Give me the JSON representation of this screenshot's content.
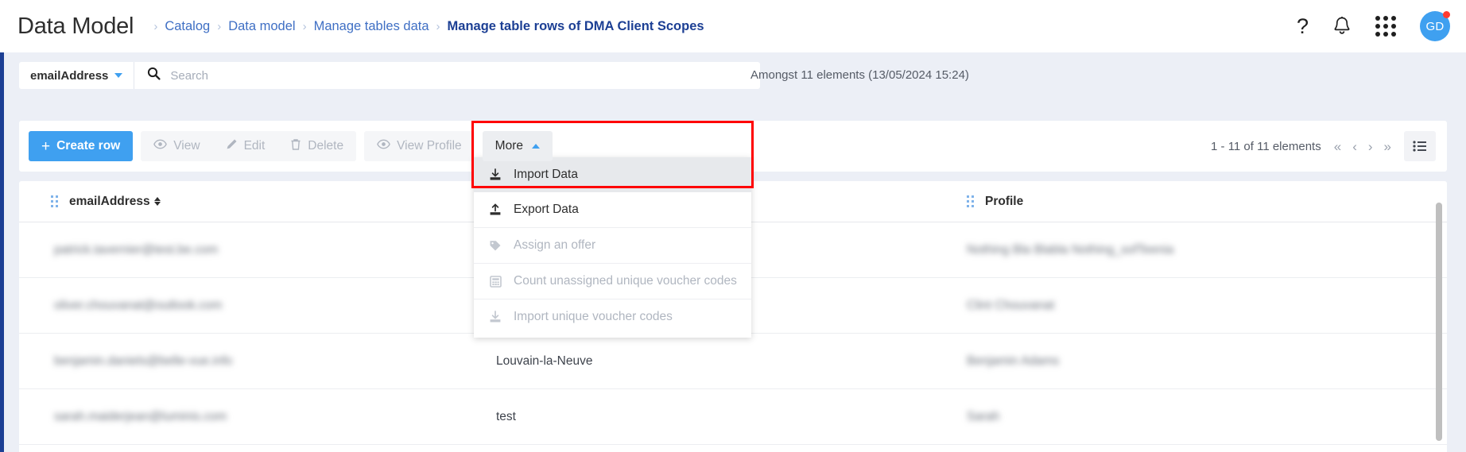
{
  "header": {
    "app_title": "Data Model",
    "breadcrumb": [
      {
        "label": "Catalog",
        "current": false
      },
      {
        "label": "Data model",
        "current": false
      },
      {
        "label": "Manage tables data",
        "current": false
      },
      {
        "label": "Manage table rows of DMA Client Scopes",
        "current": true
      }
    ],
    "separator": "›",
    "icons": {
      "help": "?",
      "help_name": "help-icon",
      "bell_name": "notifications-bell-icon",
      "grid_name": "apps-grid-icon"
    },
    "avatar_initials": "GD"
  },
  "search": {
    "field_label": "emailAddress",
    "placeholder": "Search",
    "value": "",
    "result_summary": "Amongst 11 elements (13/05/2024 15:24)"
  },
  "toolbar": {
    "create_row_label": "Create row",
    "create_row_plus": "+",
    "view_label": "View",
    "edit_label": "Edit",
    "delete_label": "Delete",
    "view_profile_label": "View Profile",
    "more_label": "More"
  },
  "more_menu": {
    "items": [
      {
        "label": "Import Data",
        "icon": "import-icon",
        "disabled": false,
        "highlighted": true
      },
      {
        "label": "Export Data",
        "icon": "export-icon",
        "disabled": false,
        "highlighted": false
      },
      {
        "label": "Assign an offer",
        "icon": "tag-icon",
        "disabled": true,
        "highlighted": false
      },
      {
        "label": "Count unassigned unique voucher codes",
        "icon": "calculator-icon",
        "disabled": true,
        "highlighted": false
      },
      {
        "label": "Import unique voucher codes",
        "icon": "import-icon",
        "disabled": true,
        "highlighted": false
      }
    ]
  },
  "pagination": {
    "range_text": "1 - 11 of 11 elements",
    "first": "«",
    "prev": "‹",
    "next": "›",
    "last": "»"
  },
  "table": {
    "columns": [
      {
        "label": "emailAddress",
        "sortable": true
      },
      {
        "label": "",
        "sortable": false
      },
      {
        "label": "Profile",
        "sortable": false
      }
    ],
    "rows": [
      {
        "email": "patrick.tavernier@test.be.com",
        "middle": "",
        "profile": "Nothing Bla Blabla  Nothing_sofTeenia"
      },
      {
        "email": "oliver.chouvanat@outlook.com",
        "middle": "",
        "profile": "Clint Chouvanat"
      },
      {
        "email": "benjamin.daniels@belle-vue.info",
        "middle": "Louvain-la-Neuve",
        "profile": "Benjamin Adams"
      },
      {
        "email": "sarah.maiderjean@luminis.com",
        "middle": "test",
        "profile": "Sarah"
      }
    ]
  },
  "colors": {
    "accent": "#3fa0f0",
    "breadcrumb_link": "#3f6fc4",
    "breadcrumb_current": "#1c3f94",
    "page_background": "#eceff6",
    "rail": "#1c3f94",
    "highlight_box": "#ff0000",
    "menu_active": "#e7e9ec",
    "avatar_badge": "#ff3b30"
  }
}
